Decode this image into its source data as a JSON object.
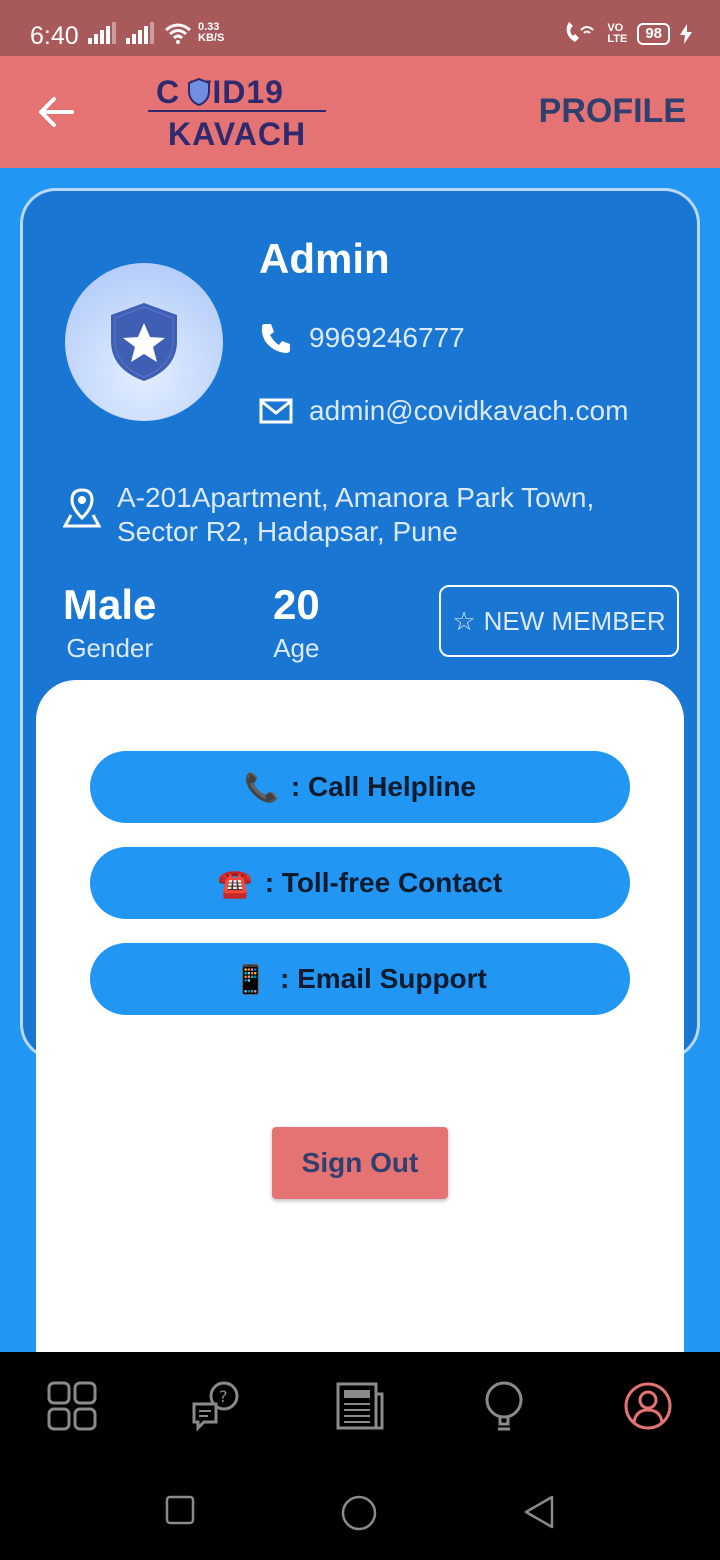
{
  "status_bar": {
    "time": "6:40",
    "net_speed_value": "0.33",
    "net_speed_unit": "KB/S",
    "volte_top": "VO",
    "volte_bottom": "LTE",
    "battery": "98"
  },
  "app_bar": {
    "logo_top": "C  VID19",
    "logo_bottom": "KAVACH",
    "title": "PROFILE"
  },
  "profile": {
    "name": "Admin",
    "phone": "9969246777",
    "email": "admin@covidkavach.com",
    "address_line1": "A-201Apartment, Amanora Park Town,",
    "address_line2": "Sector R2, Hadapsar, Pune",
    "gender_value": "Male",
    "gender_label": "Gender",
    "age_value": "20",
    "age_label": "Age",
    "member_badge_icon": "☆",
    "member_badge_label": "NEW MEMBER"
  },
  "actions": {
    "call_helpline_icon": "📞",
    "call_helpline_label": ": Call Helpline",
    "tollfree_icon": "☎️",
    "tollfree_label": ": Toll-free Contact",
    "email_support_icon": "📱",
    "email_support_label": ": Email Support",
    "signout_label": "Sign Out"
  },
  "bottom_nav": {
    "items": [
      "dashboard-icon",
      "faq-chat-icon",
      "news-icon",
      "tips-bulb-icon",
      "profile-icon"
    ],
    "active": "profile-icon",
    "active_color": "#e57373"
  },
  "colors": {
    "app_bar": "#e57373",
    "background": "#2196f3",
    "card": "#1976d2",
    "status_bar": "#a85a5a"
  }
}
